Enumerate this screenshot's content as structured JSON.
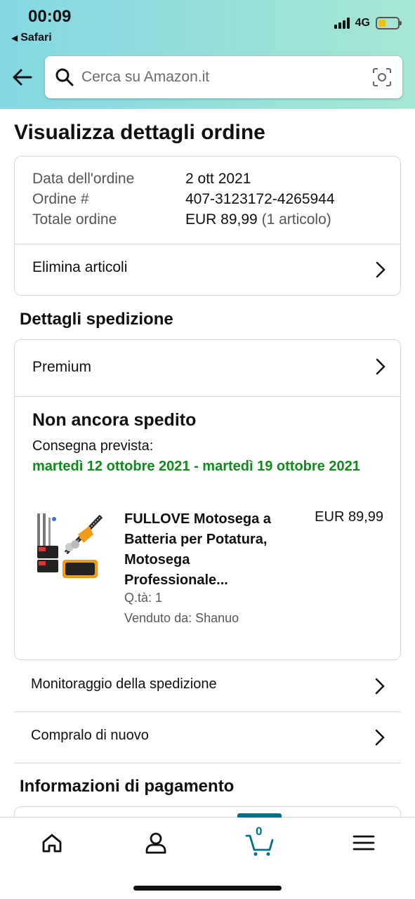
{
  "status_bar": {
    "time": "00:09",
    "back_app": "Safari",
    "network": "4G"
  },
  "search": {
    "placeholder": "Cerca su Amazon.it"
  },
  "page": {
    "title": "Visualizza dettagli ordine"
  },
  "order_summary": {
    "rows": [
      {
        "label": "Data dell'ordine",
        "value": "2 ott 2021"
      },
      {
        "label": "Ordine #",
        "value": "407-3123172-4265944"
      },
      {
        "label": "Totale ordine",
        "value": "EUR 89,99",
        "extra": "(1 articolo)"
      }
    ],
    "action": "Elimina articoli"
  },
  "shipping": {
    "section_title": "Dettagli spedizione",
    "method": "Premium",
    "status": "Non ancora spedito",
    "delivery_label": "Consegna prevista:",
    "delivery_dates": "martedì 12 ottobre 2021 - martedì 19 ottobre 2021",
    "item": {
      "title": "FULLOVE Motosega a Batteria per Potatura, Motosega Professionale...",
      "price": "EUR 89,99",
      "quantity": "Q.tà: 1",
      "seller": "Venduto da: Shanuo"
    }
  },
  "actions": [
    {
      "label": "Monitoraggio della spedizione"
    },
    {
      "label": "Compralo di nuovo"
    }
  ],
  "payment": {
    "section_title": "Informazioni di pagamento"
  },
  "bottom_nav": {
    "cart_count": "0",
    "items": [
      "home-icon",
      "account-icon",
      "cart-icon",
      "menu-icon"
    ]
  },
  "colors": {
    "header_gradient_start": "#84d8e3",
    "header_gradient_end": "#a6e6d4",
    "delivery_green": "#118a1c",
    "accent_teal": "#007185"
  }
}
